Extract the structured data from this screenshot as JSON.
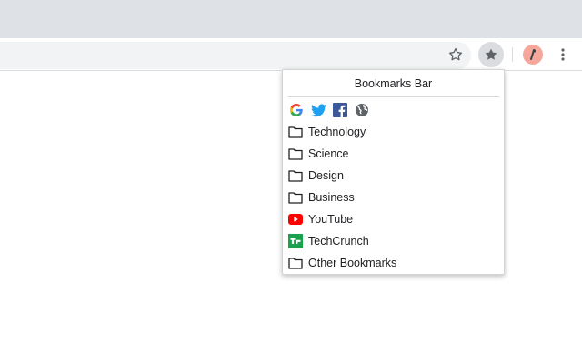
{
  "browser": {
    "icons": {
      "bookmark_star": "star-outline-icon",
      "bookmarks_extension": "star-filled-icon",
      "menu": "kebab-menu-icon"
    }
  },
  "popup": {
    "title": "Bookmarks Bar",
    "quick_links": [
      {
        "name": "google-icon"
      },
      {
        "name": "twitter-icon"
      },
      {
        "name": "facebook-icon"
      },
      {
        "name": "globe-icon"
      }
    ],
    "items": [
      {
        "label": "Technology",
        "icon": "folder-icon"
      },
      {
        "label": "Science",
        "icon": "folder-icon"
      },
      {
        "label": "Design",
        "icon": "folder-icon"
      },
      {
        "label": "Business",
        "icon": "folder-icon"
      },
      {
        "label": "YouTube",
        "icon": "youtube-icon"
      },
      {
        "label": "TechCrunch",
        "icon": "techcrunch-icon"
      },
      {
        "label": "Other Bookmarks",
        "icon": "folder-icon"
      }
    ]
  },
  "colors": {
    "tabstrip": "#dee1e6",
    "omnibox": "#f1f3f4",
    "youtube": "#ff0000",
    "techcrunch": "#1ca24c",
    "twitter": "#1da1f2",
    "facebook": "#3b5998"
  }
}
